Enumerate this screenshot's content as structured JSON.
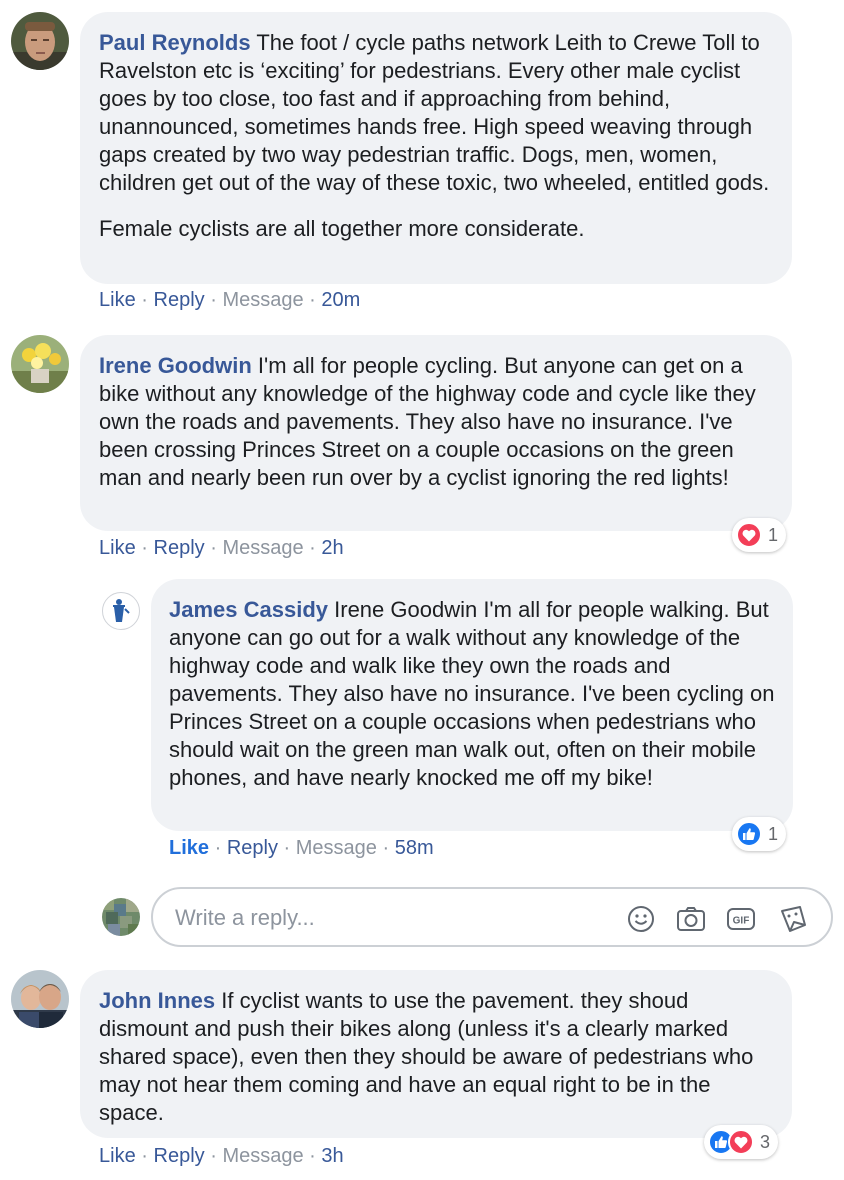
{
  "comments": [
    {
      "author": "Paul Reynolds",
      "paragraphs": [
        "The foot / cycle paths network Leith to Crewe Toll to Ravelston etc is ‘exciting’ for pedestrians. Every other male cyclist goes by too close, too fast and if approaching from behind, unannounced, sometimes hands free. High speed weaving through gaps created by two way pedestrian traffic. Dogs, men, women, children get out of the way of these toxic, two wheeled, entitled gods.",
        "Female cyclists are all together more considerate."
      ],
      "actions": {
        "like": "Like",
        "reply": "Reply",
        "message": "Message",
        "time": "20m"
      }
    },
    {
      "author": "Irene Goodwin",
      "paragraphs": [
        "I'm all for people cycling. But anyone can get on a bike without any knowledge of the highway code and cycle like they own the roads and pavements. They also have no insurance. I've been crossing Princes Street on a couple occasions on the green man and nearly been run over by a cyclist ignoring the red lights!"
      ],
      "actions": {
        "like": "Like",
        "reply": "Reply",
        "message": "Message",
        "time": "2h"
      },
      "reactions": {
        "icons": [
          "love"
        ],
        "count": "1"
      }
    },
    {
      "author": "James Cassidy",
      "paragraphs": [
        "Irene Goodwin I'm all for people walking. But anyone can go out for a walk without any knowledge of the highway code and walk like they own the roads and pavements. They also have no insurance. I've been cycling on Princes Street on a couple occasions when pedestrians who should wait on the green man walk out, often on their mobile phones, and have nearly knocked me off my bike!"
      ],
      "actions": {
        "like": "Like",
        "reply": "Reply",
        "message": "Message",
        "time": "58m"
      },
      "reactions": {
        "icons": [
          "like"
        ],
        "count": "1"
      }
    },
    {
      "author": "John Innes",
      "paragraphs": [
        "If cyclist wants to use the pavement. they shoud dismount and push their bikes along (unless it's a clearly marked shared space), even then they should be aware of pedestrians who may not hear them coming and have an equal right to be in the space."
      ],
      "actions": {
        "like": "Like",
        "reply": "Reply",
        "message": "Message",
        "time": "3h"
      },
      "reactions": {
        "icons": [
          "like",
          "love"
        ],
        "count": "3"
      }
    }
  ],
  "reply_box": {
    "placeholder": "Write a reply...",
    "tools": [
      "smiley-icon",
      "camera-icon",
      "gif-icon",
      "sticker-icon"
    ]
  },
  "colors": {
    "author": "#385898",
    "meta": "#8d949e",
    "bubble": "#f0f2f5",
    "love": "#f33e58",
    "like": "#1877f2"
  }
}
